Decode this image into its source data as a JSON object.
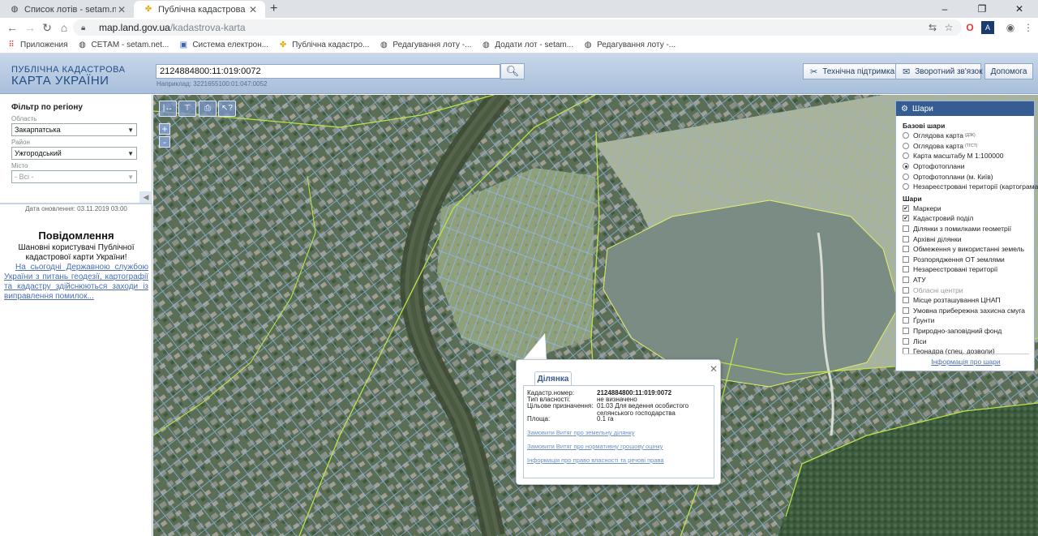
{
  "browser": {
    "tabs": [
      {
        "title": "Список лотів - setam.net.ua",
        "active": false
      },
      {
        "title": "Публічна кадастрова карта Укр",
        "active": true
      }
    ],
    "url_host": "map.land.gov.ua",
    "url_path": "/kadastrova-karta",
    "bookmarks": [
      "Приложения",
      "СЕТАМ - setam.net...",
      "Система електрон...",
      "Публічна кадастро...",
      "Редагування лоту -...",
      "Додати лот - setam...",
      "Редагування лоту -..."
    ]
  },
  "header": {
    "logo_line1": "ПУБЛІЧНА КАДАСТРОВА",
    "logo_line2": "КАРТА УКРАЇНИ",
    "search_value": "2124884800:11:019:0072",
    "search_hint": "Наприклад: 3221655100:01:047:0052",
    "support": "Технічна підтримка",
    "feedback": "Зворотний зв'язок",
    "help": "Допомога"
  },
  "filter": {
    "title": "Фільтр по регіону",
    "region_label": "Область",
    "region_value": "Закарпатська",
    "district_label": "Район",
    "district_value": "Ужгородський",
    "city_label": "Місто",
    "city_value": "- Всі -"
  },
  "left": {
    "updated": "Дата оновлення: 03.11.2019 03:00",
    "msg_title": "Повідомлення",
    "msg_greeting": "Шановні користувачі Публічної кадастрової карти України!",
    "msg_link": "На сьогодні Державною службою України з питань геодезії, картографії та кадастру здійснюються заходи із виправлення помилок..."
  },
  "map_tools": {
    "zoom_in": "+",
    "zoom_out": "-"
  },
  "layers": {
    "title": "Шари",
    "base_title": "Базові шари",
    "base": [
      {
        "label": "Оглядова карта",
        "sup": "(ДЗК)",
        "checked": false
      },
      {
        "label": "Оглядова карта",
        "sup": "(ТГСТ)",
        "checked": false
      },
      {
        "label": "Карта масштабу М 1:100000",
        "sup": "",
        "checked": false
      },
      {
        "label": "Ортофотоплани",
        "sup": "",
        "checked": true
      },
      {
        "label": "Ортофотоплани (м. Київ)",
        "sup": "",
        "checked": false
      },
      {
        "label": "Незареєстровані території (картограма)",
        "sup": "",
        "checked": false
      }
    ],
    "layers_title": "Шари",
    "items": [
      {
        "label": "Маркери",
        "checked": true,
        "dim": false
      },
      {
        "label": "Кадастровий поділ",
        "checked": true,
        "dim": false
      },
      {
        "label": "Ділянки з помилками геометрії",
        "checked": false,
        "dim": false
      },
      {
        "label": "Архівні ділянки",
        "checked": false,
        "dim": false
      },
      {
        "label": "Обмеження у використанні земель",
        "checked": false,
        "dim": false
      },
      {
        "label": "Розпорядження ОТ землями",
        "checked": false,
        "dim": false
      },
      {
        "label": "Незареєстровані території",
        "checked": false,
        "dim": false
      },
      {
        "label": "АТУ",
        "checked": false,
        "dim": false
      },
      {
        "label": "Обласні центри",
        "checked": false,
        "dim": true
      },
      {
        "label": "Місце розташування ЦНАП",
        "checked": false,
        "dim": false
      },
      {
        "label": "Умовна прибережна захисна смуга",
        "checked": false,
        "dim": false
      },
      {
        "label": "Ґрунти",
        "checked": false,
        "dim": false
      },
      {
        "label": "Природно-заповідний фонд",
        "checked": false,
        "dim": false
      },
      {
        "label": "Ліси",
        "checked": false,
        "dim": false
      },
      {
        "label": "Геонадра (спец. дозволи)",
        "checked": false,
        "dim": false
      }
    ],
    "info_link": "Інформація про шари"
  },
  "popup": {
    "tab": "Ділянка",
    "rows": [
      {
        "key": "Кадастр.номер:",
        "value": "2124884800:11:019:0072",
        "bold": true
      },
      {
        "key": "Тип власності:",
        "value": "не визначено",
        "bold": false
      },
      {
        "key": "Цільове призначення:",
        "value": "01.03 Для ведення особистого селянського господарства",
        "bold": false
      },
      {
        "key": "Площа:",
        "value": "0.1 га",
        "bold": false
      }
    ],
    "link1": "Замовити Витяг про земельну ділянку",
    "link2": "Замовити Витяг про нормативну грошову оцінку",
    "link3": "Інформація про право власності та речові права"
  }
}
